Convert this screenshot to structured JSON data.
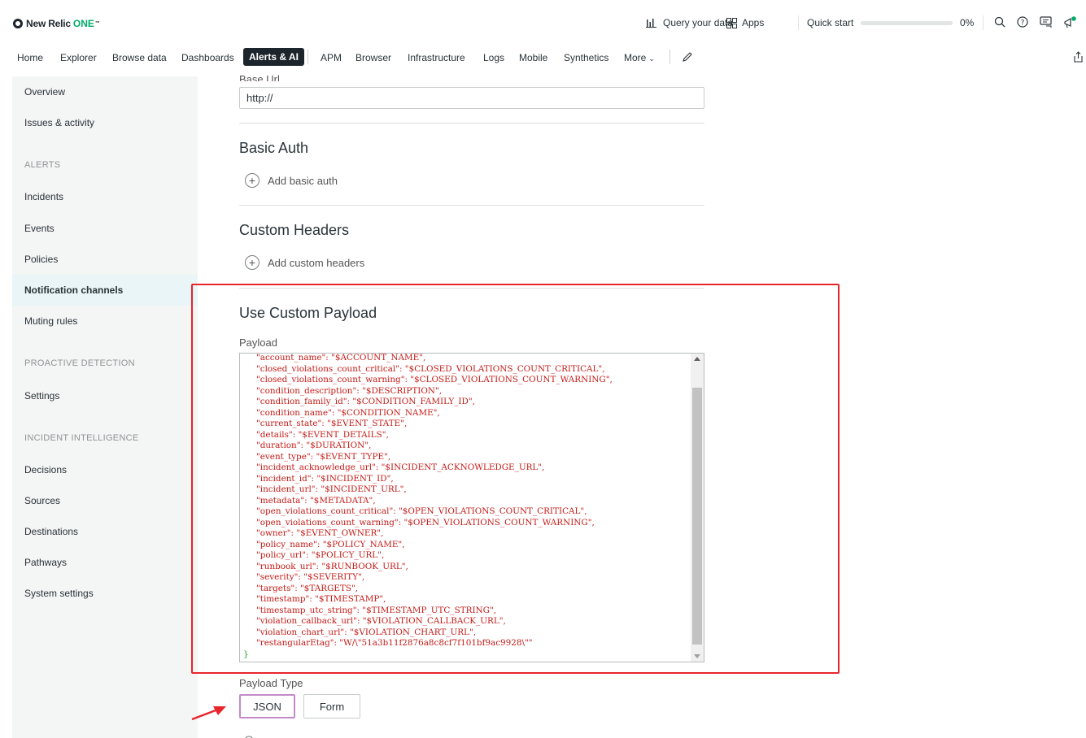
{
  "topbar": {
    "logo_brand": "New Relic",
    "logo_one": "ONE",
    "logo_tm": "™",
    "query_data": "Query your data",
    "apps": "Apps",
    "quick_start": "Quick start",
    "quick_start_progress_percent": 0,
    "quick_start_pct": "0%"
  },
  "nav": {
    "items": [
      "Home",
      "Explorer",
      "Browse data",
      "Dashboards",
      "Alerts & AI",
      "APM",
      "Browser",
      "Infrastructure",
      "Logs",
      "Mobile",
      "Synthetics",
      "More"
    ],
    "active": "Alerts & AI"
  },
  "sidebar": {
    "overview": "Overview",
    "issues": "Issues & activity",
    "alerts_head": "ALERTS",
    "incidents": "Incidents",
    "events": "Events",
    "policies": "Policies",
    "notification_channels": "Notification channels",
    "muting_rules": "Muting rules",
    "proactive_head": "PROACTIVE DETECTION",
    "settings": "Settings",
    "intel_head": "INCIDENT INTELLIGENCE",
    "decisions": "Decisions",
    "sources": "Sources",
    "destinations": "Destinations",
    "pathways": "Pathways",
    "system_settings": "System settings"
  },
  "form": {
    "base_url_label": "Base Url",
    "base_url_value": "http://",
    "basic_auth_title": "Basic Auth",
    "add_basic_auth": "Add basic auth",
    "custom_headers_title": "Custom Headers",
    "add_custom_headers": "Add custom headers",
    "custom_payload_title": "Use Custom Payload",
    "payload_label": "Payload",
    "payload_lines": [
      "\"account_name\": \"$ACCOUNT_NAME\",",
      "\"closed_violations_count_critical\": \"$CLOSED_VIOLATIONS_COUNT_CRITICAL\",",
      "\"closed_violations_count_warning\": \"$CLOSED_VIOLATIONS_COUNT_WARNING\",",
      "\"condition_description\": \"$DESCRIPTION\",",
      "\"condition_family_id\": \"$CONDITION_FAMILY_ID\",",
      "\"condition_name\": \"$CONDITION_NAME\",",
      "\"current_state\": \"$EVENT_STATE\",",
      "\"details\": \"$EVENT_DETAILS\",",
      "\"duration\": \"$DURATION\",",
      "\"event_type\": \"$EVENT_TYPE\",",
      "\"incident_acknowledge_url\": \"$INCIDENT_ACKNOWLEDGE_URL\",",
      "\"incident_id\": \"$INCIDENT_ID\",",
      "\"incident_url\": \"$INCIDENT_URL\",",
      "\"metadata\": \"$METADATA\",",
      "\"open_violations_count_critical\": \"$OPEN_VIOLATIONS_COUNT_CRITICAL\",",
      "\"open_violations_count_warning\": \"$OPEN_VIOLATIONS_COUNT_WARNING\",",
      "\"owner\": \"$EVENT_OWNER\",",
      "\"policy_name\": \"$POLICY_NAME\",",
      "\"policy_url\": \"$POLICY_URL\",",
      "\"runbook_url\": \"$RUNBOOK_URL\",",
      "\"severity\": \"$SEVERITY\",",
      "\"targets\": \"$TARGETS\",",
      "\"timestamp\": \"$TIMESTAMP\",",
      "\"timestamp_utc_string\": \"$TIMESTAMP_UTC_STRING\",",
      "\"violation_callback_url\": \"$VIOLATION_CALLBACK_URL\",",
      "\"violation_chart_url\": \"$VIOLATION_CHART_URL\",",
      "\"restangularEtag\": \"W/\\\"51a3b11f2876a8c8cf7f101bf9ac9928\\\"\""
    ],
    "closing_brace": "}",
    "payload_type_label": "Payload Type",
    "payload_type_options": [
      "JSON",
      "Form"
    ],
    "payload_type_selected": "JSON"
  },
  "colors": {
    "annotation_red": "#e8252b",
    "code_red": "#c41a16",
    "brand_green": "#00ac69",
    "selected_purple": "#c48bc9"
  }
}
